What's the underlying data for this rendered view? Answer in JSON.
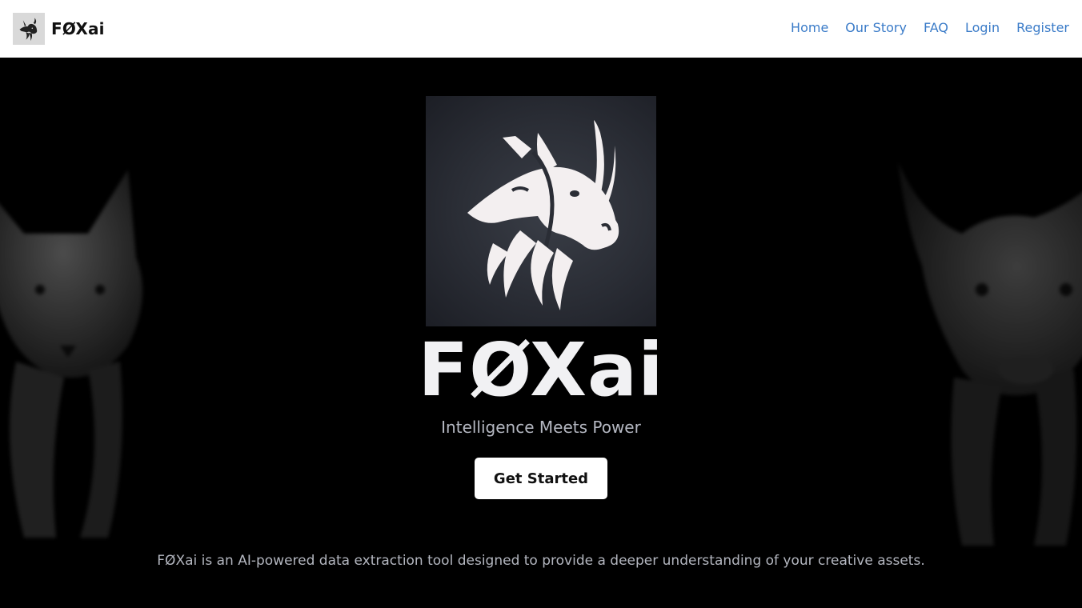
{
  "navbar": {
    "brand_name": "FØXai",
    "links": [
      {
        "label": "Home"
      },
      {
        "label": "Our Story"
      },
      {
        "label": "FAQ"
      },
      {
        "label": "Login"
      },
      {
        "label": "Register"
      }
    ]
  },
  "hero": {
    "title": "FØXai",
    "subtitle": "Intelligence Meets Power",
    "cta_label": "Get Started",
    "description": "FØXai is an AI-powered data extraction tool designed to provide a deeper understanding of your creative assets."
  },
  "colors": {
    "nav_link": "#3a7bc8",
    "hero_background": "#000000",
    "logo_tile": "#2a2d35",
    "button_background": "#ffffff"
  },
  "icons": {
    "brand_logo": "fox-bull-logo-icon",
    "hero_logo": "fox-bull-logo-icon",
    "background_left": "fox-image",
    "background_right": "bull-image"
  }
}
